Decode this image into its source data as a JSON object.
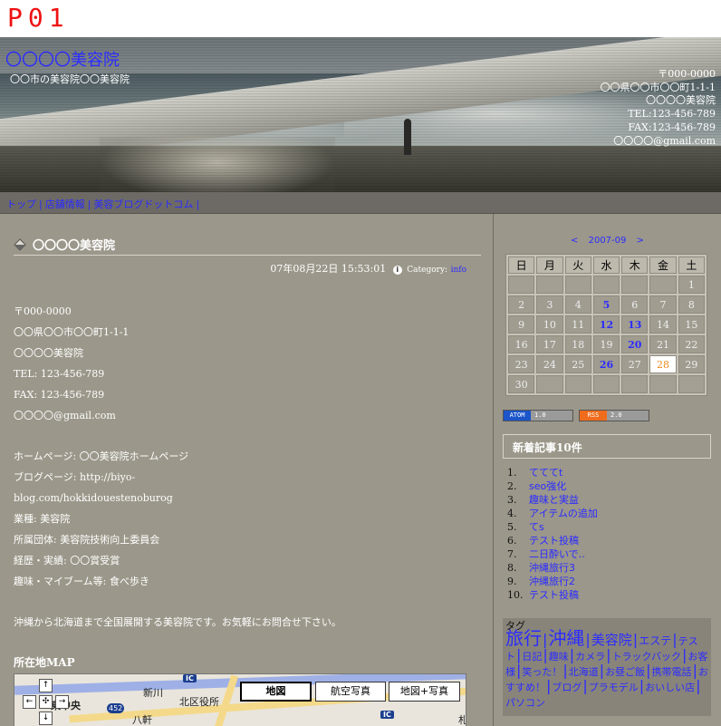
{
  "page_label": "P01",
  "header": {
    "title": "〇〇〇〇美容院",
    "subtitle": "〇〇市の美容院〇〇美容院",
    "contact": [
      "〒000-0000",
      "〇〇県〇〇市〇〇町1-1-1",
      "〇〇〇〇美容院",
      "TEL:123-456-789",
      "FAX:123-456-789",
      "〇〇〇〇@gmail.com"
    ]
  },
  "nav": {
    "items": [
      "トップ",
      "店舗情報",
      "美容ブログドットコム"
    ]
  },
  "entry": {
    "title": "〇〇〇〇美容院",
    "date": "07年08月22日 15:53:01",
    "category_label": "Category:",
    "category": "info",
    "lines_1": [
      "〒000-0000",
      "〇〇県〇〇市〇〇町1-1-1",
      "〇〇〇〇美容院",
      "TEL: 123-456-789",
      "FAX: 123-456-789",
      "〇〇〇〇@gmail.com"
    ],
    "lines_2": [
      "ホームページ: 〇〇美容院ホームページ",
      "ブログページ: http://biyo-",
      "blog.com/hokkidouestenoburog",
      "業種: 美容院",
      "所属団体: 美容院技術向上委員会",
      "経歴・実績: 〇〇賞受賞",
      "趣味・マイブーム等: 食べ歩き"
    ],
    "message": "沖縄から北海道まで全国展開する美容院です。お気軽にお問合せ下さい。"
  },
  "map": {
    "title": "所在地MAP",
    "buttons": [
      "地図",
      "航空写真",
      "地図+写真"
    ],
    "places": [
      "新川",
      "北区役所",
      "東中央",
      "八軒",
      "札"
    ],
    "ic_label": "IC",
    "route_number": "452",
    "controls": [
      "↑",
      "←",
      "✣",
      "→",
      "↓"
    ]
  },
  "calendar": {
    "prev": "<",
    "month": "2007-09",
    "next": ">",
    "weekdays": [
      "日",
      "月",
      "火",
      "水",
      "木",
      "金",
      "土"
    ],
    "weeks": [
      [
        "",
        "",
        "",
        "",
        "",
        "",
        "1"
      ],
      [
        "2",
        "3",
        "4",
        "5",
        "6",
        "7",
        "8"
      ],
      [
        "9",
        "10",
        "11",
        "12",
        "13",
        "14",
        "15"
      ],
      [
        "16",
        "17",
        "18",
        "19",
        "20",
        "21",
        "22"
      ],
      [
        "23",
        "24",
        "25",
        "26",
        "27",
        "28",
        "29"
      ],
      [
        "30",
        "",
        "",
        "",
        "",
        "",
        ""
      ]
    ],
    "linked_days": [
      "5",
      "12",
      "13",
      "20",
      "26"
    ],
    "today": "28"
  },
  "feeds": [
    {
      "key": "ATOM",
      "version": "1.0",
      "color": "#1b55c9"
    },
    {
      "key": "RSS",
      "version": "2.0",
      "color": "#ef6c1c"
    }
  ],
  "recent": {
    "title": "新着記事10件",
    "items": [
      "てててt",
      "seo強化",
      "趣味と実益",
      "アイテムの追加",
      "てs",
      "テスト投稿",
      "二日酔いで‥",
      "沖縄旅行3",
      "沖縄旅行2",
      "テスト投稿"
    ]
  },
  "tags": {
    "title": "タグ",
    "items": [
      {
        "label": "旅行",
        "size": 20
      },
      {
        "label": "沖縄",
        "size": 20
      },
      {
        "label": "美容院",
        "size": 15
      },
      {
        "label": "エステ",
        "size": 12
      },
      {
        "label": "テスト",
        "size": 11
      },
      {
        "label": "日記",
        "size": 11
      },
      {
        "label": "趣味",
        "size": 11
      },
      {
        "label": "カメラ",
        "size": 11
      },
      {
        "label": "トラックバック",
        "size": 11
      },
      {
        "label": "お客様",
        "size": 11
      },
      {
        "label": "笑った！",
        "size": 11
      },
      {
        "label": "北海道",
        "size": 11
      },
      {
        "label": "お昼ご飯",
        "size": 11
      },
      {
        "label": "携帯電話",
        "size": 11
      },
      {
        "label": "おすすめ！",
        "size": 11
      },
      {
        "label": "ブログ",
        "size": 11
      },
      {
        "label": "プラモデル",
        "size": 11
      },
      {
        "label": "おいしい店",
        "size": 11
      },
      {
        "label": "パソコン",
        "size": 11
      }
    ]
  }
}
